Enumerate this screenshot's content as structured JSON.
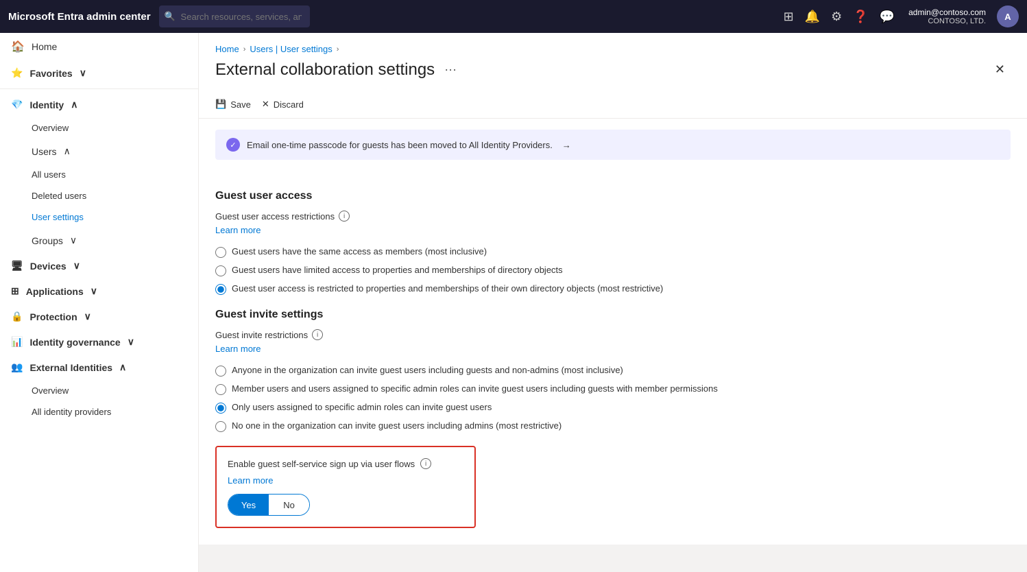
{
  "app": {
    "title": "Microsoft Entra admin center"
  },
  "topnav": {
    "search_placeholder": "Search resources, services, and docs (G+/)",
    "user_email": "admin@contoso.com",
    "user_org": "CONTOSO, LTD.",
    "user_initials": "A"
  },
  "sidebar": {
    "home_label": "Home",
    "favorites_label": "Favorites",
    "identity_label": "Identity",
    "overview_label": "Overview",
    "users_label": "Users",
    "all_users_label": "All users",
    "deleted_users_label": "Deleted users",
    "user_settings_label": "User settings",
    "groups_label": "Groups",
    "devices_label": "Devices",
    "applications_label": "Applications",
    "protection_label": "Protection",
    "identity_governance_label": "Identity governance",
    "external_identities_label": "External Identities",
    "ext_overview_label": "Overview",
    "all_identity_providers_label": "All identity providers"
  },
  "breadcrumb": {
    "home": "Home",
    "users_settings": "Users | User settings"
  },
  "page": {
    "title": "External collaboration settings",
    "save_label": "Save",
    "discard_label": "Discard"
  },
  "banner": {
    "message": "Email one-time passcode for guests has been moved to All Identity Providers.",
    "arrow": "→"
  },
  "guest_user_access": {
    "section_title": "Guest user access",
    "field_label": "Guest user access restrictions",
    "learn_more": "Learn more",
    "options": [
      "Guest users have the same access as members (most inclusive)",
      "Guest users have limited access to properties and memberships of directory objects",
      "Guest user access is restricted to properties and memberships of their own directory objects (most restrictive)"
    ],
    "selected_index": 2
  },
  "guest_invite": {
    "section_title": "Guest invite settings",
    "field_label": "Guest invite restrictions",
    "learn_more": "Learn more",
    "options": [
      "Anyone in the organization can invite guest users including guests and non-admins (most inclusive)",
      "Member users and users assigned to specific admin roles can invite guest users including guests with member permissions",
      "Only users assigned to specific admin roles can invite guest users",
      "No one in the organization can invite guest users including admins (most restrictive)"
    ],
    "selected_index": 2
  },
  "self_service": {
    "label": "Enable guest self-service sign up via user flows",
    "learn_more": "Learn more",
    "toggle_yes": "Yes",
    "toggle_no": "No",
    "active": "yes"
  }
}
